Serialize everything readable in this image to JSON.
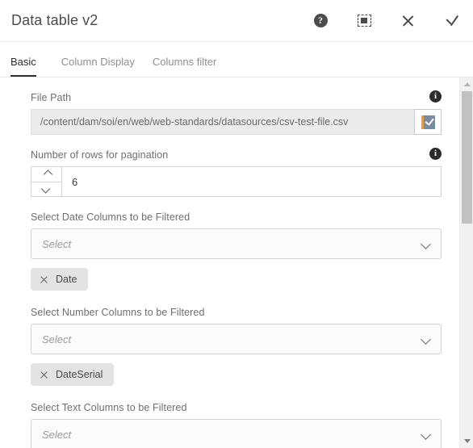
{
  "dialog": {
    "title": "Data table v2",
    "actions": [
      {
        "name": "help-icon",
        "label": "?"
      },
      {
        "name": "fullscreen-icon",
        "label": ""
      },
      {
        "name": "close-icon",
        "label": ""
      },
      {
        "name": "confirm-icon",
        "label": ""
      }
    ]
  },
  "tabs": [
    {
      "label": "Basic",
      "active": true
    },
    {
      "label": "Column Display",
      "active": false
    },
    {
      "label": "Columns filter",
      "active": false
    }
  ],
  "form": {
    "file_path": {
      "label": "File Path",
      "value": "/content/dam/soi/en/web/web-standards/datasources/csv-test-file.csv",
      "info": "i",
      "picker_glyph": "✓"
    },
    "pagination": {
      "label": "Number of rows for pagination",
      "value": "6",
      "info": "i"
    },
    "date_columns": {
      "label": "Select Date Columns to be Filtered",
      "placeholder": "Select",
      "chips": [
        "Date"
      ]
    },
    "number_columns": {
      "label": "Select Number Columns to be Filtered",
      "placeholder": "Select",
      "chips": [
        "DateSerial"
      ]
    },
    "text_columns": {
      "label": "Select Text Columns to be Filtered",
      "placeholder": "Select",
      "chips": []
    }
  },
  "colors": {
    "accent_underline": "#323232",
    "chip_bg": "#e3e3e3",
    "disabled_input_bg": "#ebebeb",
    "checkbox_fill": "#7a8c9e",
    "checkbox_edge": "#d8a05a",
    "scrollbar_thumb": "#c1c1c1"
  }
}
